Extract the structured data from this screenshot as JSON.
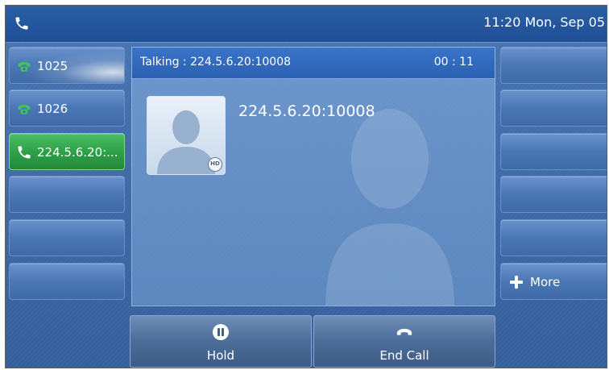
{
  "status_bar": {
    "clock": "11:20 Mon, Sep 05",
    "icon": "phone-icon"
  },
  "line_keys": [
    {
      "label": "1025",
      "icon": "phone-receiver-icon",
      "state": "registered"
    },
    {
      "label": "1026",
      "icon": "phone-receiver-icon",
      "state": "registered"
    },
    {
      "label": "224.5.6.20:...",
      "icon": "phone-call-icon",
      "state": "active"
    },
    {
      "label": ""
    },
    {
      "label": ""
    },
    {
      "label": ""
    }
  ],
  "side_keys": [
    {
      "label": ""
    },
    {
      "label": ""
    },
    {
      "label": ""
    },
    {
      "label": ""
    },
    {
      "label": ""
    },
    {
      "label": "More",
      "icon": "plus-icon"
    }
  ],
  "call": {
    "status": "Talking : 224.5.6.20:10008",
    "timer": "00 : 11",
    "remote_name": "224.5.6.20:10008",
    "hd_badge": "HD"
  },
  "softkeys": [
    {
      "label": "Hold",
      "icon": "pause-icon"
    },
    {
      "label": "End Call",
      "icon": "hang-up-icon"
    }
  ],
  "colors": {
    "active_line": "#2d9e47",
    "panel_header": "#2a60b2"
  }
}
